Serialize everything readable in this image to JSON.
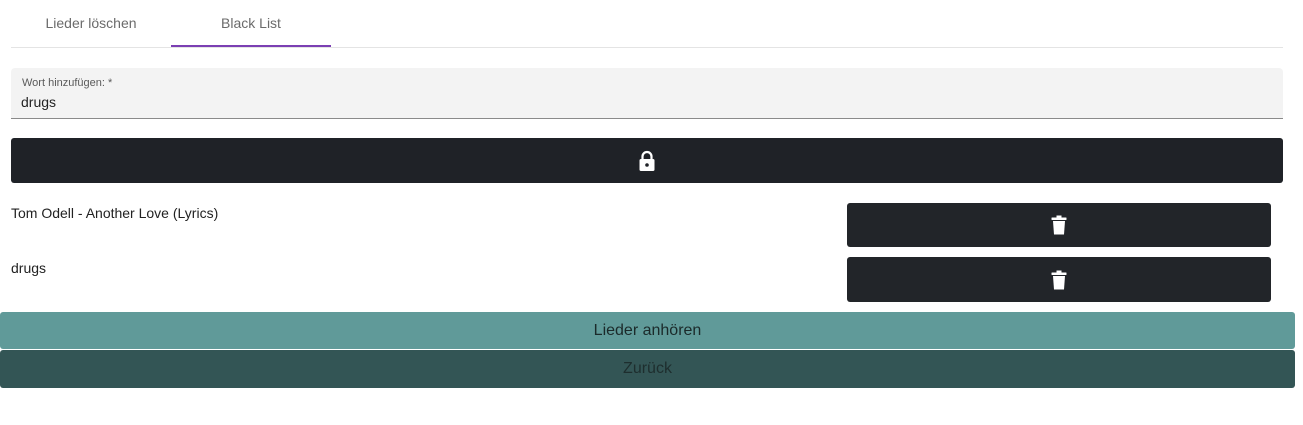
{
  "tabs": [
    {
      "label": "Lieder löschen",
      "active": false
    },
    {
      "label": "Black List",
      "active": true
    }
  ],
  "word_field": {
    "label": "Wort hinzufügen: *",
    "value": "drugs"
  },
  "lock_button": {
    "icon": "lock-icon"
  },
  "blacklist": [
    {
      "text": "Tom Odell - Another Love (Lyrics)",
      "icon": "trash-icon"
    },
    {
      "text": "drugs",
      "icon": "trash-icon"
    }
  ],
  "buttons": {
    "listen_label": "Lieder anhören",
    "back_label": "Zurück"
  },
  "colors": {
    "tab_accent": "#7b3fb3",
    "dark_button": "#1f2227",
    "listen_button": "#609a99",
    "back_button": "#335555"
  }
}
